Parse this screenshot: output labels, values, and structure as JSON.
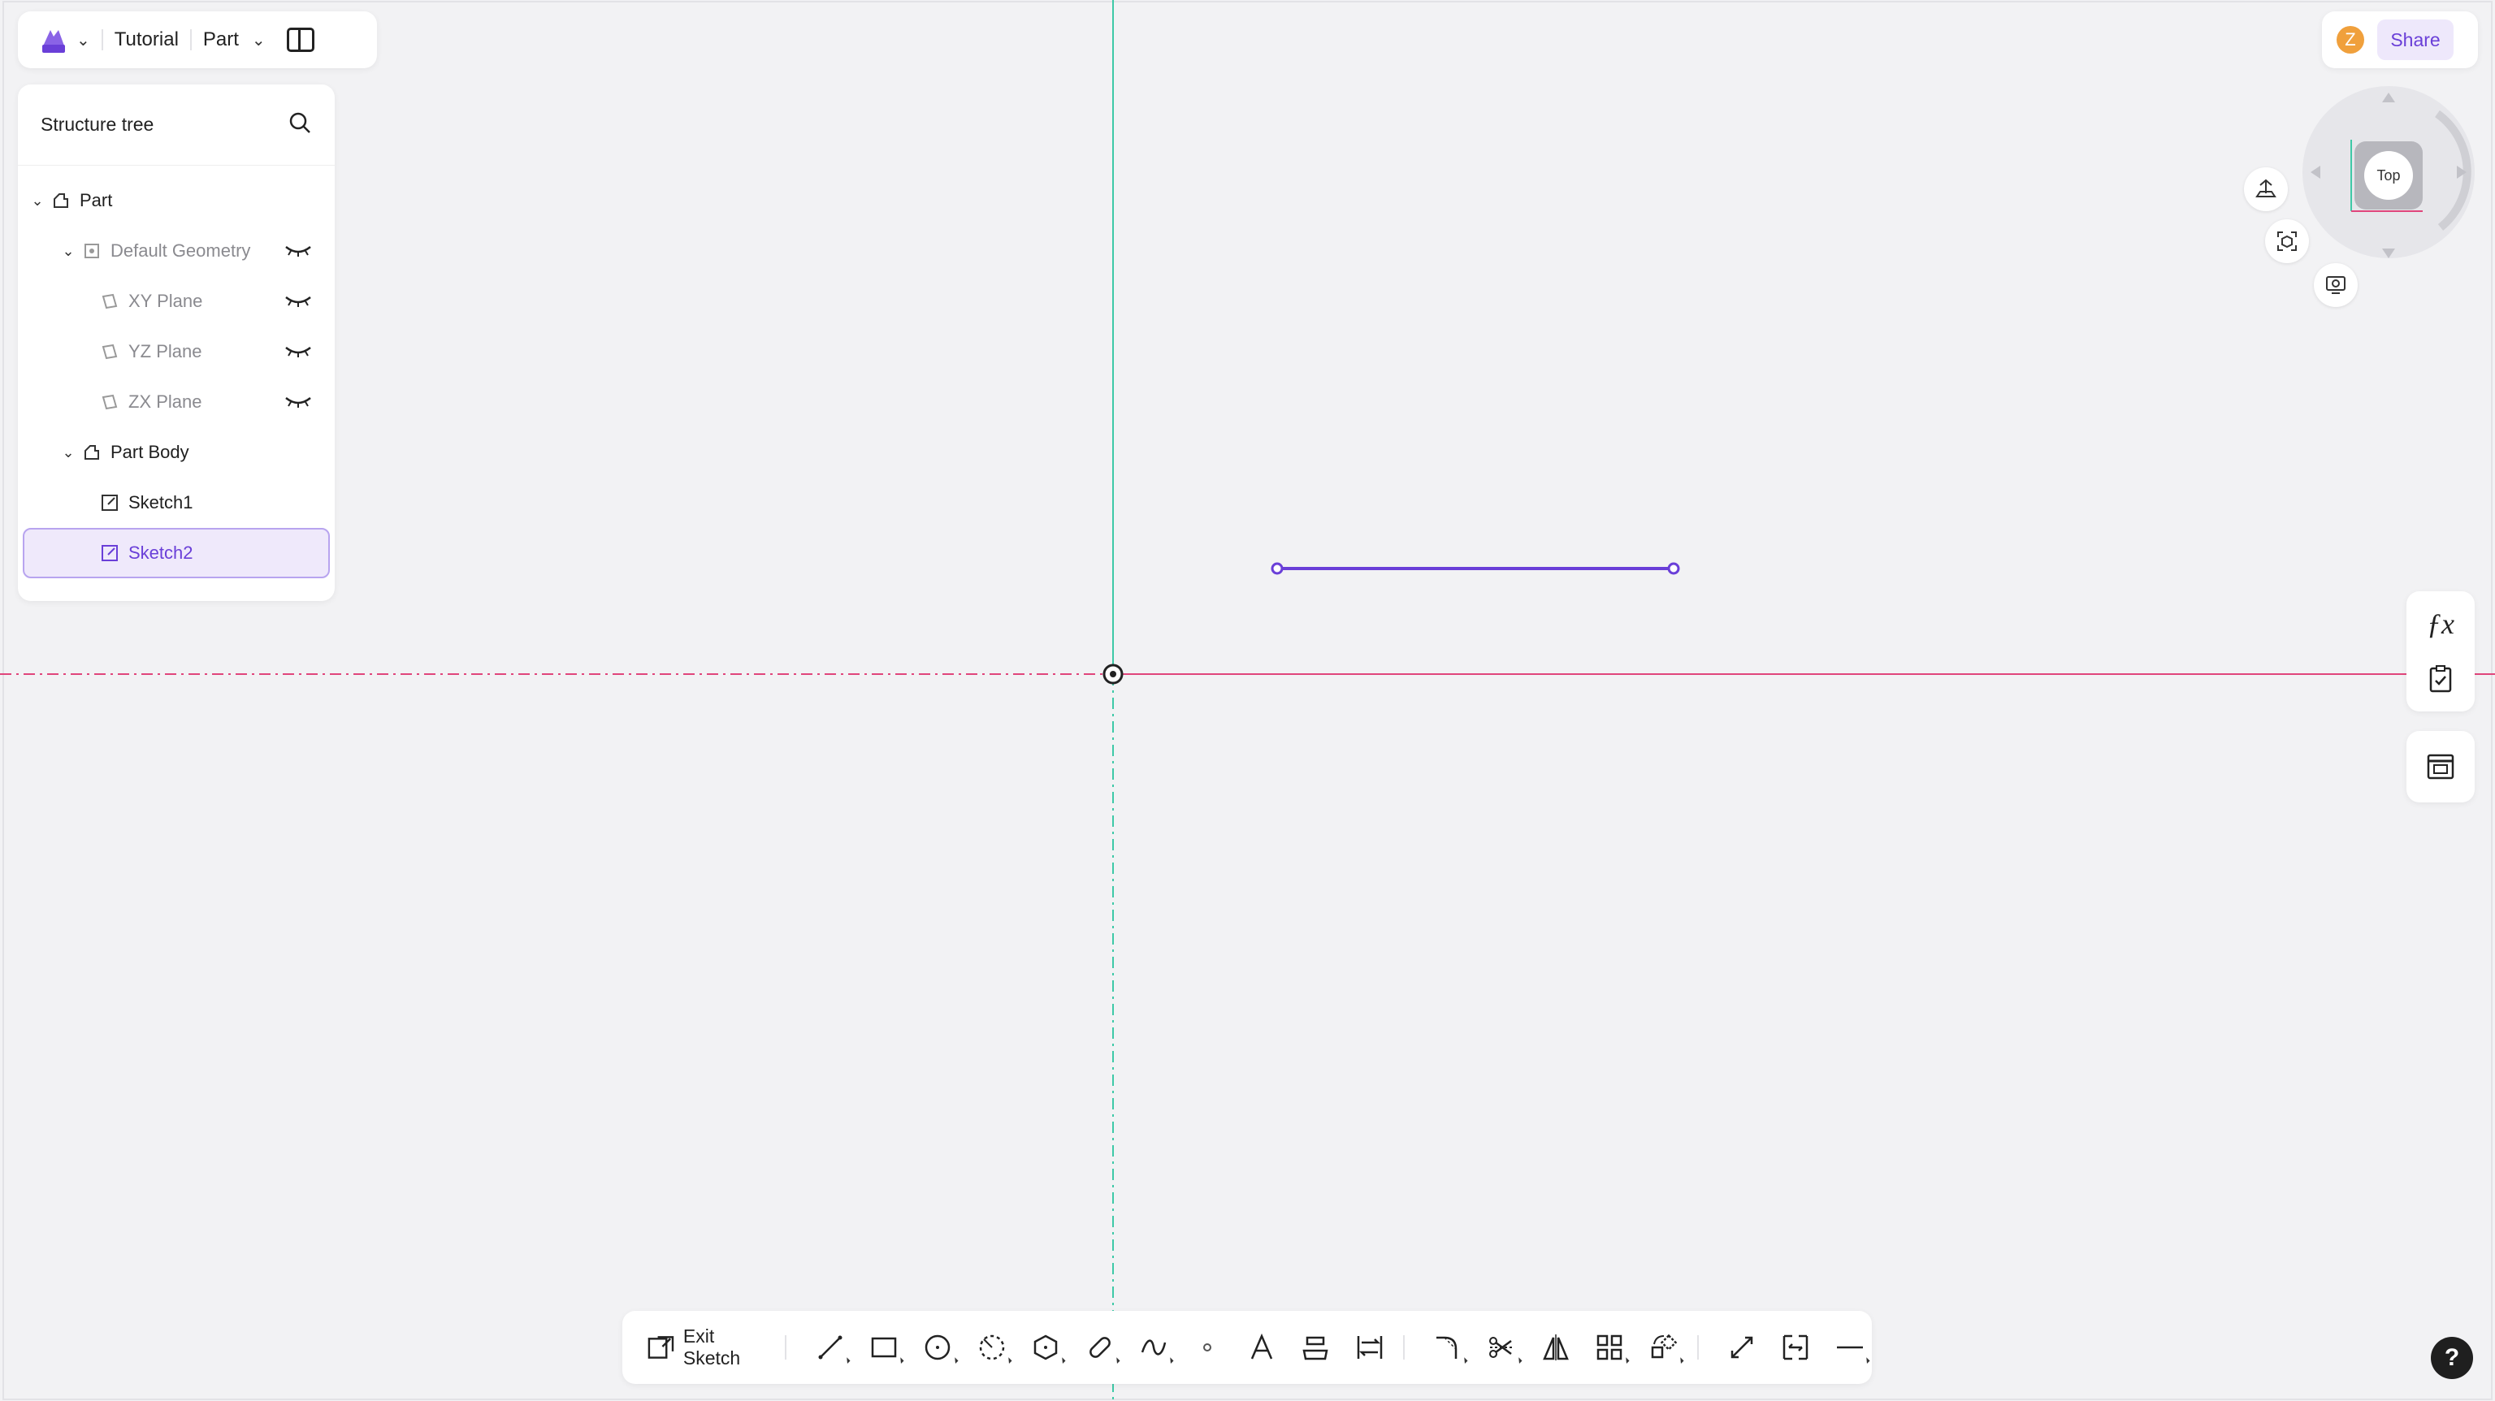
{
  "topbar": {
    "project_name": "Tutorial",
    "mode_label": "Part"
  },
  "tree": {
    "title": "Structure tree",
    "items": [
      {
        "label": "Part"
      },
      {
        "label": "Default Geometry"
      },
      {
        "label": "XY Plane"
      },
      {
        "label": "YZ Plane"
      },
      {
        "label": "ZX Plane"
      },
      {
        "label": "Part Body"
      },
      {
        "label": "Sketch1"
      },
      {
        "label": "Sketch2"
      }
    ]
  },
  "share": {
    "avatar_letter": "Z",
    "share_label": "Share"
  },
  "viewcube": {
    "face_label": "Top"
  },
  "bottom_toolbar": {
    "exit_label": "Exit Sketch"
  },
  "help": {
    "label": "?"
  },
  "colors": {
    "accent": "#6a3fd8",
    "x_axis": "#e0457b",
    "y_axis": "#3ec9a7",
    "sketch_line": "#6a3fd8"
  }
}
